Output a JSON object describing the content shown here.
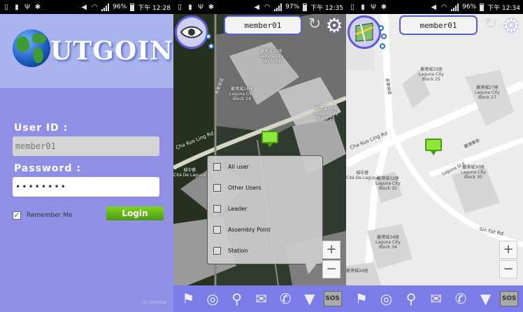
{
  "status_bars": [
    {
      "battery": "96%",
      "time": "下午 12:28"
    },
    {
      "battery": "97%",
      "time": "下午 12:35"
    },
    {
      "battery": "96%",
      "time": "下午 12:34"
    }
  ],
  "login": {
    "logo_text": "UTGOING",
    "user_id_label": "User ID :",
    "user_id_value": "member01",
    "password_label": "Password :",
    "password_value": "••••••••",
    "remember_label": "Remember Me",
    "remember_checked": true,
    "login_button": "Login",
    "footer": "LG Optimus"
  },
  "map_screen_filter": {
    "member": "member01",
    "filter_options": [
      {
        "label": "All user"
      },
      {
        "label": "Other Users"
      },
      {
        "label": "Leader"
      },
      {
        "label": "Assembly Point"
      },
      {
        "label": "Station"
      }
    ],
    "map_labels": [
      "麗港城35座\nLaguna City\nBlock 35",
      "麗港城24座\nLaguna City\nBlock 24",
      "麗港城28座\nLaguna City\nBlock 28",
      "茶果嶺道",
      "Cha Kuo Ling Rd",
      "城中薈\nCité De Laguna"
    ]
  },
  "map_screen_street": {
    "member": "member01",
    "map_labels": [
      "麗港城25座\nLaguna City\nBlock 25",
      "麗港城27座\nLaguna City\nBlock 27",
      "麗港城30座\nLaguna City\nBlock 30",
      "麗港城32座\nLaguna City\nBlock 32",
      "麗港城34座\nLaguna City\nBlock 34",
      "茶果嶺道",
      "Cha Kuo Ling Rd",
      "城中薈\nCité De Laguna",
      "Laguna St E",
      "麗港東街",
      "Sin Fat Rd",
      "麗港城26座"
    ]
  },
  "icons": {
    "eye": "eye-icon",
    "map": "map-icon",
    "refresh": "refresh-icon",
    "settings": "gear-icon",
    "bottom": [
      "flag-map-icon",
      "target-icon",
      "search-icon",
      "mail-icon",
      "phone-icon",
      "filter-icon",
      "sos-icon"
    ]
  },
  "bottom_bar": {
    "sos_label": "SOS"
  },
  "zoom": {
    "in": "+",
    "out": "−"
  },
  "colors": {
    "accent": "#7c7ce8",
    "login_bg": "#8f8fe6",
    "login_button": "#6cc11a",
    "pin": "#8de83d"
  }
}
